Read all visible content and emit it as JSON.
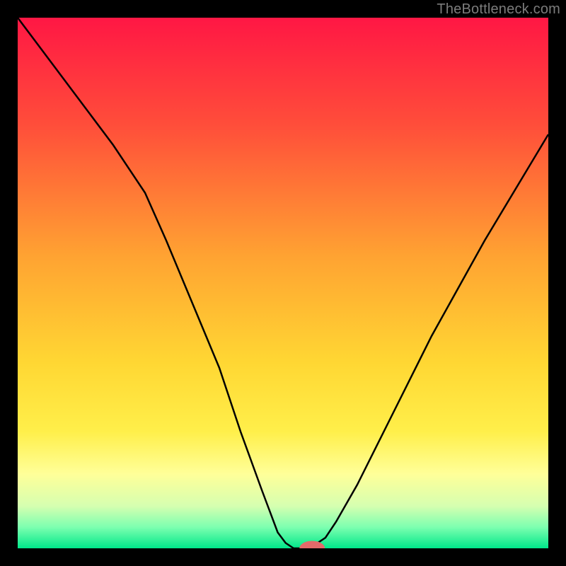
{
  "watermark": "TheBottleneck.com",
  "chart_data": {
    "type": "line",
    "title": "",
    "xlabel": "",
    "ylabel": "",
    "xlim": [
      0,
      100
    ],
    "ylim": [
      0,
      100
    ],
    "background_gradient": {
      "stops": [
        {
          "pos": 0.0,
          "color": "#ff1744"
        },
        {
          "pos": 0.2,
          "color": "#ff4d3a"
        },
        {
          "pos": 0.45,
          "color": "#ffa332"
        },
        {
          "pos": 0.65,
          "color": "#ffd733"
        },
        {
          "pos": 0.78,
          "color": "#ffef4a"
        },
        {
          "pos": 0.86,
          "color": "#ffff99"
        },
        {
          "pos": 0.92,
          "color": "#d6ffb0"
        },
        {
          "pos": 0.96,
          "color": "#7dffb0"
        },
        {
          "pos": 1.0,
          "color": "#00e88a"
        }
      ]
    },
    "series": [
      {
        "name": "bottleneck-curve",
        "color": "#000000",
        "stroke_width": 2.5,
        "x": [
          0,
          6,
          12,
          18,
          24,
          28,
          33,
          38,
          42,
          46,
          49,
          50.5,
          52,
          55,
          58,
          60,
          64,
          70,
          78,
          88,
          100
        ],
        "y": [
          100,
          92,
          84,
          76,
          67,
          58,
          46,
          34,
          22,
          11,
          3,
          1,
          0,
          0,
          2,
          5,
          12,
          24,
          40,
          58,
          78
        ]
      }
    ],
    "marker": {
      "name": "target-marker",
      "x": 55.5,
      "y": 0,
      "rx": 2.4,
      "ry": 1.4,
      "color": "#e46a6a"
    }
  }
}
